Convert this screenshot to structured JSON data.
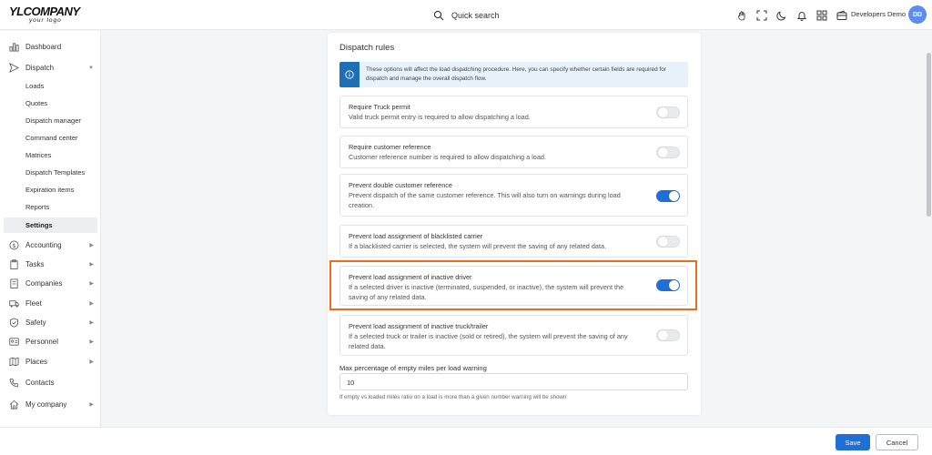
{
  "header": {
    "logo_main": "YLCOMPANY",
    "logo_sub": "your logo",
    "search_label": "Quick search",
    "icons": [
      "hand-icon",
      "fullscreen-icon",
      "moon-icon",
      "bell-icon",
      "apps-grid-icon",
      "wallet-icon"
    ],
    "user_name": "Developers Demo",
    "avatar_initials": "DD"
  },
  "sidebar": {
    "dashboard": "Dashboard",
    "dispatch": "Dispatch",
    "dispatch_sub": [
      "Loads",
      "Quotes",
      "Dispatch manager",
      "Command center",
      "Matrices",
      "Dispatch Templates",
      "Expiration items",
      "Reports",
      "Settings"
    ],
    "active_sub": "Settings",
    "items": [
      "Accounting",
      "Tasks",
      "Companies",
      "Fleet",
      "Safety",
      "Personnel",
      "Places",
      "Contacts",
      "My company"
    ]
  },
  "card": {
    "title": "Dispatch rules",
    "info_text": "These options will affect the load dispatching procedure. Here, you can specify whether certain fields are required for dispatch and manage the overall dispatch flow.",
    "rules": [
      {
        "title": "Require Truck permit",
        "desc": "Valid truck permit entry is required to allow dispatching a load.",
        "enabled": false
      },
      {
        "title": "Require customer reference",
        "desc": "Customer reference number is required to allow dispatching a load.",
        "enabled": false
      },
      {
        "title": "Prevent double customer reference",
        "desc": "Prevent dispatch of the same customer reference. This will also turn on warnings during load creation.",
        "enabled": true
      },
      {
        "title": "Prevent load assignment of blacklisted carrier",
        "desc": "If a blacklisted carrier is selected, the system will prevent the saving of any related data.",
        "enabled": false
      },
      {
        "title": "Prevent load assignment of inactive driver",
        "desc": "If a selected driver is inactive (terminated, suspended, or inactive), the system will prevent the saving of any related data.",
        "enabled": true
      },
      {
        "title": "Prevent load assignment of inactive truck/trailer",
        "desc": "If a selected truck or trailer is inactive (sold or retired), the system will prevent the saving of any related data.",
        "enabled": false
      }
    ],
    "max_empty_label": "Max percentage of empty miles per load warning",
    "max_empty_value": "10",
    "max_empty_help": "If empty vs loaded miles ratio on a load is more than a given number warning will be shown"
  },
  "footer": {
    "save_label": "Save",
    "cancel_label": "Cancel"
  },
  "colors": {
    "accent": "#1f6fd6",
    "highlight": "#ee6a21",
    "info_bg": "#e7f2fb"
  }
}
